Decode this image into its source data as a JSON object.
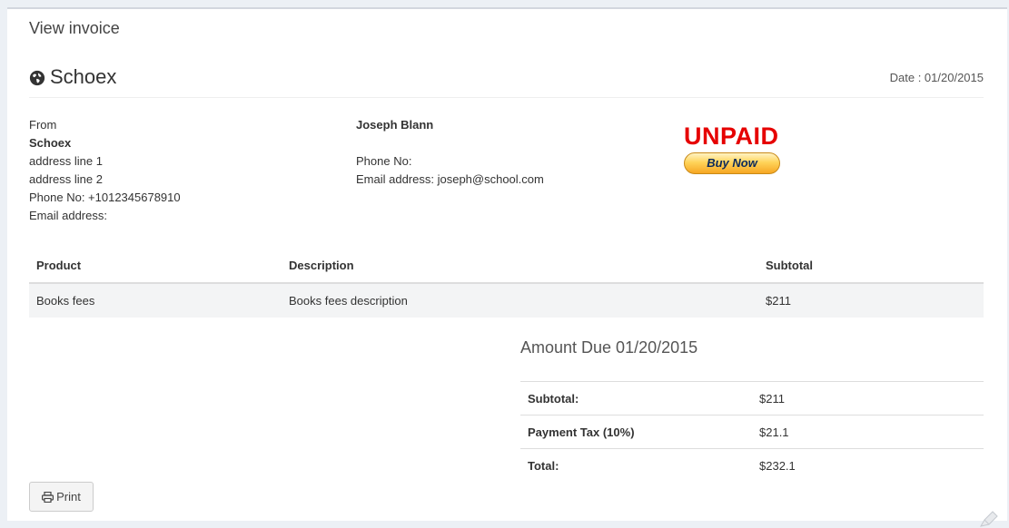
{
  "box": {
    "title": "View invoice"
  },
  "header": {
    "company": "Schoex",
    "date": "Date : 01/20/2015"
  },
  "from": {
    "label": "From",
    "name": "Schoex",
    "address1": "address line 1",
    "address2": "address line 2",
    "phone": "Phone No: +1012345678910",
    "email": "Email address:"
  },
  "to": {
    "name": "Joseph Blann",
    "phone": "Phone No:",
    "email": "Email address: joseph@school.com"
  },
  "status": {
    "label": "UNPAID",
    "buy_now": "Buy Now",
    "color": "#e60000"
  },
  "items": {
    "headers": [
      "Product",
      "Description",
      "Subtotal"
    ],
    "rows": [
      [
        "Books fees",
        "Books fees description",
        "$211"
      ]
    ]
  },
  "amount_due": "Amount Due 01/20/2015",
  "totals": [
    {
      "label": "Subtotal:",
      "value": "$211"
    },
    {
      "label": "Payment Tax (10%)",
      "value": "$21.1"
    },
    {
      "label": "Total:",
      "value": "$232.1"
    }
  ],
  "print": {
    "label": "Print"
  },
  "icons": {
    "logo": "globe-icon",
    "print": "print-icon",
    "corner": "pencil-icon"
  }
}
